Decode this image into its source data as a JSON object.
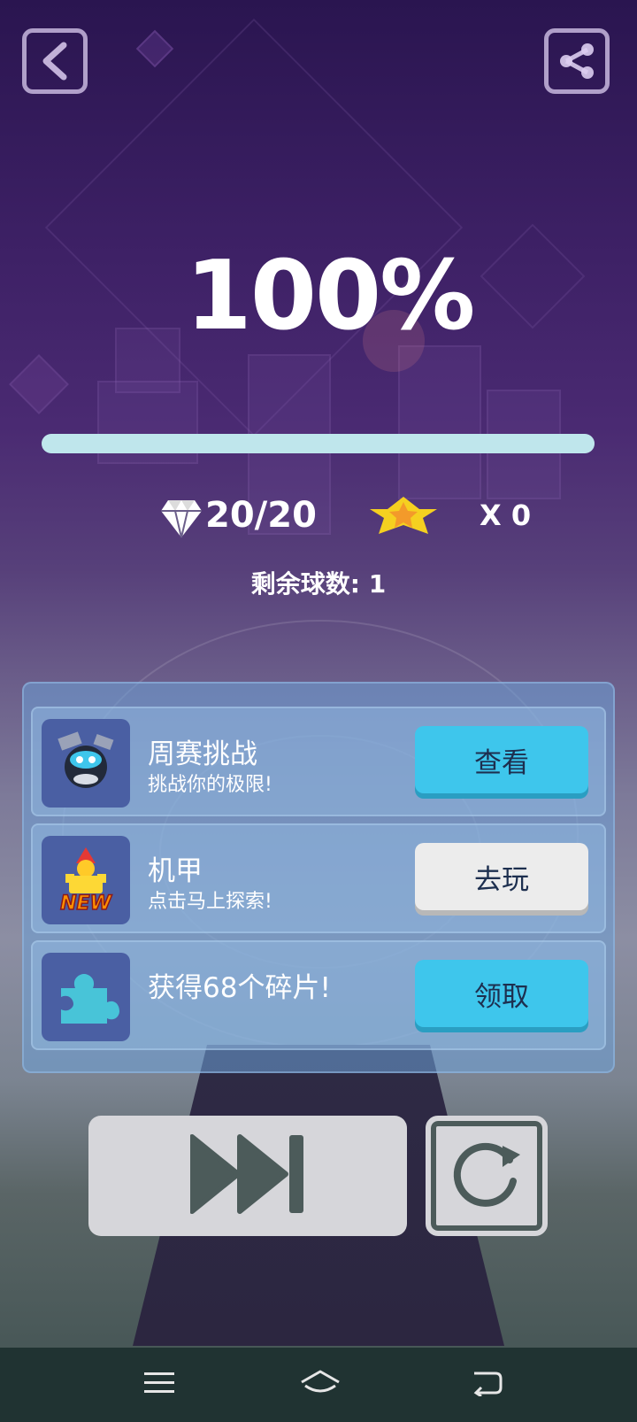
{
  "header": {
    "back_icon": "back-arrow-icon",
    "share_icon": "share-icon"
  },
  "result": {
    "percent_text": "100%",
    "progress": 1.0,
    "gems_text": "20/20",
    "stars_text": "X 0",
    "balls_left_text": "剩余球数: 1"
  },
  "tasks": [
    {
      "title": "周赛挑战",
      "subtitle": "挑战你的极限!",
      "button": "查看",
      "button_style": "blue",
      "icon": "robot-ball-icon"
    },
    {
      "title": "机甲",
      "subtitle": "点击马上探索!",
      "button": "去玩",
      "button_style": "gray",
      "icon": "new-mecha-icon",
      "icon_badge": "NEW"
    },
    {
      "title": "获得68个碎片!",
      "subtitle": "",
      "button": "领取",
      "button_style": "blue",
      "icon": "puzzle-piece-icon"
    }
  ],
  "controls": {
    "skip_icon": "skip-forward-icon",
    "retry_icon": "retry-icon"
  },
  "nav": {
    "menu_icon": "menu-icon",
    "home_icon": "home-icon",
    "back_icon": "system-back-icon"
  },
  "colors": {
    "accent_blue": "#3ec6ec",
    "progress_fill": "#bfe6ec",
    "gold_star": "#f5d020"
  }
}
